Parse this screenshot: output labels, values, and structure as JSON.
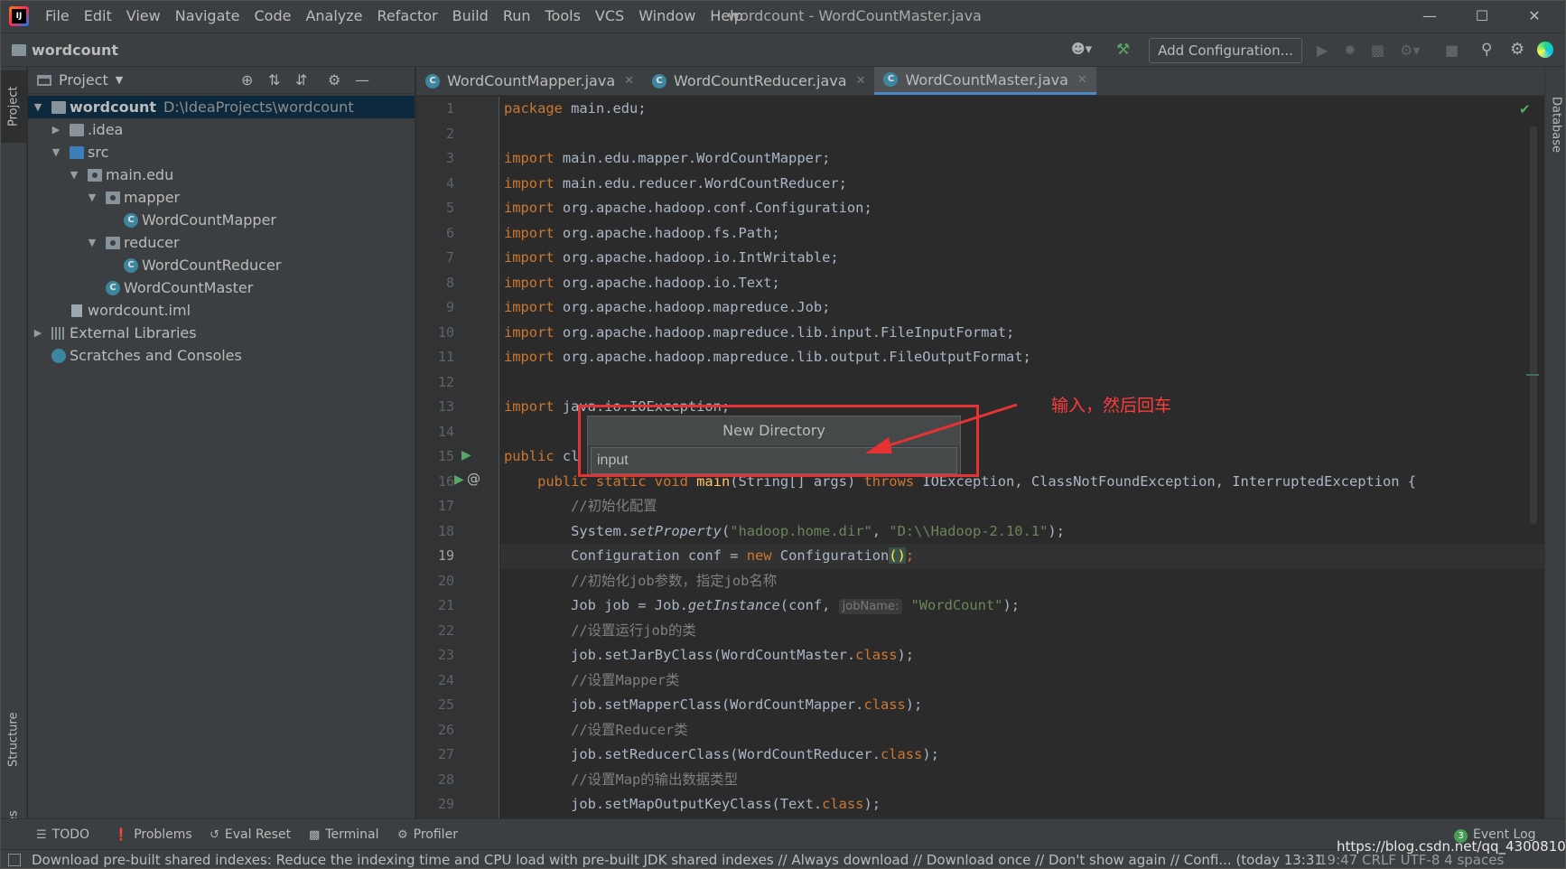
{
  "menubar": {
    "items": [
      "File",
      "Edit",
      "View",
      "Navigate",
      "Code",
      "Analyze",
      "Refactor",
      "Build",
      "Run",
      "Tools",
      "VCS",
      "Window",
      "Help"
    ],
    "window_title": "wordcount - WordCountMaster.java"
  },
  "navbar": {
    "project_name": "wordcount",
    "add_configuration": "Add Configuration..."
  },
  "side_tabs": {
    "project": "Project",
    "structure": "Structure",
    "favorites": "Favorites",
    "database": "Database"
  },
  "project_panel": {
    "title": "Project",
    "tree": [
      {
        "label": "wordcount",
        "path": "D:\\IdeaProjects\\wordcount",
        "icon": "folder-icon"
      },
      {
        "label": ".idea",
        "icon": "folder-icon"
      },
      {
        "label": "src",
        "icon": "source-folder-icon"
      },
      {
        "label": "main.edu",
        "icon": "package-icon"
      },
      {
        "label": "mapper",
        "icon": "package-icon"
      },
      {
        "label": "WordCountMapper",
        "icon": "class-icon"
      },
      {
        "label": "reducer",
        "icon": "package-icon"
      },
      {
        "label": "WordCountReducer",
        "icon": "class-icon"
      },
      {
        "label": "WordCountMaster",
        "icon": "class-icon"
      },
      {
        "label": "wordcount.iml",
        "icon": "iml-file-icon"
      },
      {
        "label": "External Libraries",
        "icon": "library-icon"
      },
      {
        "label": "Scratches and Consoles",
        "icon": "scratch-icon"
      }
    ]
  },
  "editor_tabs": [
    {
      "label": "WordCountMapper.java",
      "active": false
    },
    {
      "label": "WordCountReducer.java",
      "active": false
    },
    {
      "label": "WordCountMaster.java",
      "active": true
    }
  ],
  "editor": {
    "line_numbers": [
      "1",
      "2",
      "3",
      "4",
      "5",
      "6",
      "7",
      "8",
      "9",
      "10",
      "11",
      "12",
      "13",
      "14",
      "15",
      "16",
      "17",
      "18",
      "19",
      "20",
      "21",
      "22",
      "23",
      "24",
      "25",
      "26",
      "27",
      "28",
      "29"
    ],
    "current_line": "19",
    "code": {
      "l1_kw": "package",
      "l1_rest": " main.edu;",
      "l3_kw": "import",
      "l3_rest": " main.edu.mapper.WordCountMapper;",
      "l4_kw": "import",
      "l4_rest": " main.edu.reducer.WordCountReducer;",
      "l5_kw": "import",
      "l5_rest": " org.apache.hadoop.conf.Configuration;",
      "l6_kw": "import",
      "l6_rest": " org.apache.hadoop.fs.Path;",
      "l7_kw": "import",
      "l7_rest": " org.apache.hadoop.io.IntWritable;",
      "l8_kw": "import",
      "l8_rest": " org.apache.hadoop.io.Text;",
      "l9_kw": "import",
      "l9_rest": " org.apache.hadoop.mapreduce.Job;",
      "l10_kw": "import",
      "l10_rest": " org.apache.hadoop.mapreduce.lib.input.FileInputFormat;",
      "l11_kw": "import",
      "l11_rest": " org.apache.hadoop.mapreduce.lib.output.FileOutputFormat;",
      "l13_kw": "import",
      "l13_rest": " java.io.IOException;",
      "l15_kw": "public",
      "l15_rest": " cl",
      "l16_indent": "    ",
      "l16_kw": "public static void",
      "l16_sp": " ",
      "l16_mth": "main",
      "l16_args": "(String[] args) ",
      "l16_throws": "throws",
      "l16_rest": " IOException, ClassNotFoundException, InterruptedException {",
      "l17": "        //初始化配置",
      "l18_a": "        System.",
      "l18_m": "setProperty",
      "l18_b": "(",
      "l18_s1": "\"hadoop.home.dir\"",
      "l18_c": ", ",
      "l18_s2": "\"D:\\\\Hadoop-2.10.1\"",
      "l18_d": ");",
      "l19_a": "        Configuration conf = ",
      "l19_kw": "new",
      "l19_b": " Configuration",
      "l19_p": "()",
      "l19_c": ";",
      "l20": "        //初始化job参数，指定job名称",
      "l21_a": "        Job job = Job.",
      "l21_m": "getInstance",
      "l21_b": "(conf, ",
      "l21_hint": "jobName:",
      "l21_s": " \"WordCount\"",
      "l21_c": ");",
      "l22": "        //设置运行job的类",
      "l23_a": "        job.setJarByClass(WordCountMaster.",
      "l23_kw": "class",
      "l23_b": ");",
      "l24": "        //设置Mapper类",
      "l25_a": "        job.setMapperClass(WordCountMapper.",
      "l25_kw": "class",
      "l25_b": ");",
      "l26": "        //设置Reducer类",
      "l27_a": "        job.setReducerClass(WordCountReducer.",
      "l27_kw": "class",
      "l27_b": ");",
      "l28": "        //设置Map的输出数据类型",
      "l29_a": "        job.setMapOutputKeyClass(Text.",
      "l29_kw": "class",
      "l29_b": ");"
    }
  },
  "popup": {
    "title": "New Directory",
    "input_value": "input"
  },
  "annotation": {
    "text": "输入，然后回车",
    "color": "#e53333"
  },
  "bottom_tools": {
    "todo": "TODO",
    "problems": "Problems",
    "eval_reset": "Eval Reset",
    "terminal": "Terminal",
    "profiler": "Profiler",
    "event_log": "Event Log",
    "event_log_count": "3"
  },
  "status_bar": {
    "message": "Download pre-built shared indexes: Reduce the indexing time and CPU load with pre-built JDK shared indexes // Always download // Download once // Don't show again // Confi... (today 13:31",
    "right": "19:47  CRLF  UTF-8  4 spaces",
    "watermark": "https://blog.csdn.net/qq_43008103"
  }
}
